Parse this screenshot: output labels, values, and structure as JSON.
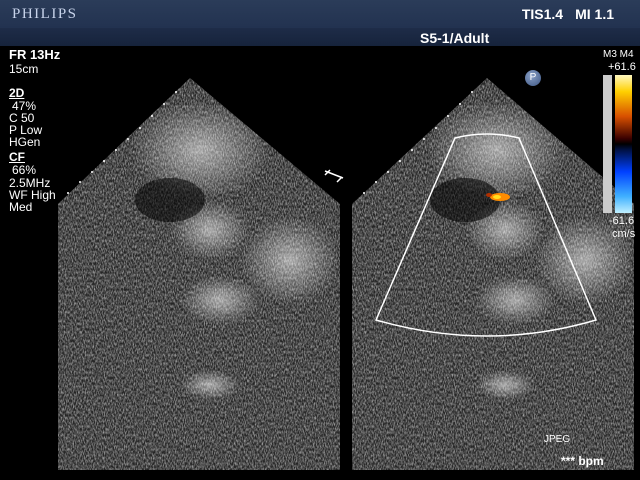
{
  "header": {
    "brand": "PHILIPS",
    "tis": "TIS1.4",
    "mi": "MI 1.1",
    "probe": "S5-1/Adult"
  },
  "params": {
    "frame_rate": "FR 13Hz",
    "depth": "15cm",
    "mode_2d": "2D",
    "gain_2d": "47%",
    "compression": "C 50",
    "persistence": "P Low",
    "frequency_2d": "HGen",
    "mode_cf": "CF",
    "gain_cf": "66%",
    "frequency_cf": "2.5MHz",
    "wall_filter": "WF High",
    "flow": "Med"
  },
  "colorbar": {
    "label": "M3 M4",
    "top": "+61.6",
    "bottom": "-61.6",
    "unit": "cm/s"
  },
  "panel_badge": "P",
  "footer": {
    "format": "JPEG",
    "heart_rate": "*** bpm"
  },
  "colors": {
    "header_bg": "#223250",
    "sub_bg": "#16233b",
    "brand_text": "#c7d3ea"
  }
}
